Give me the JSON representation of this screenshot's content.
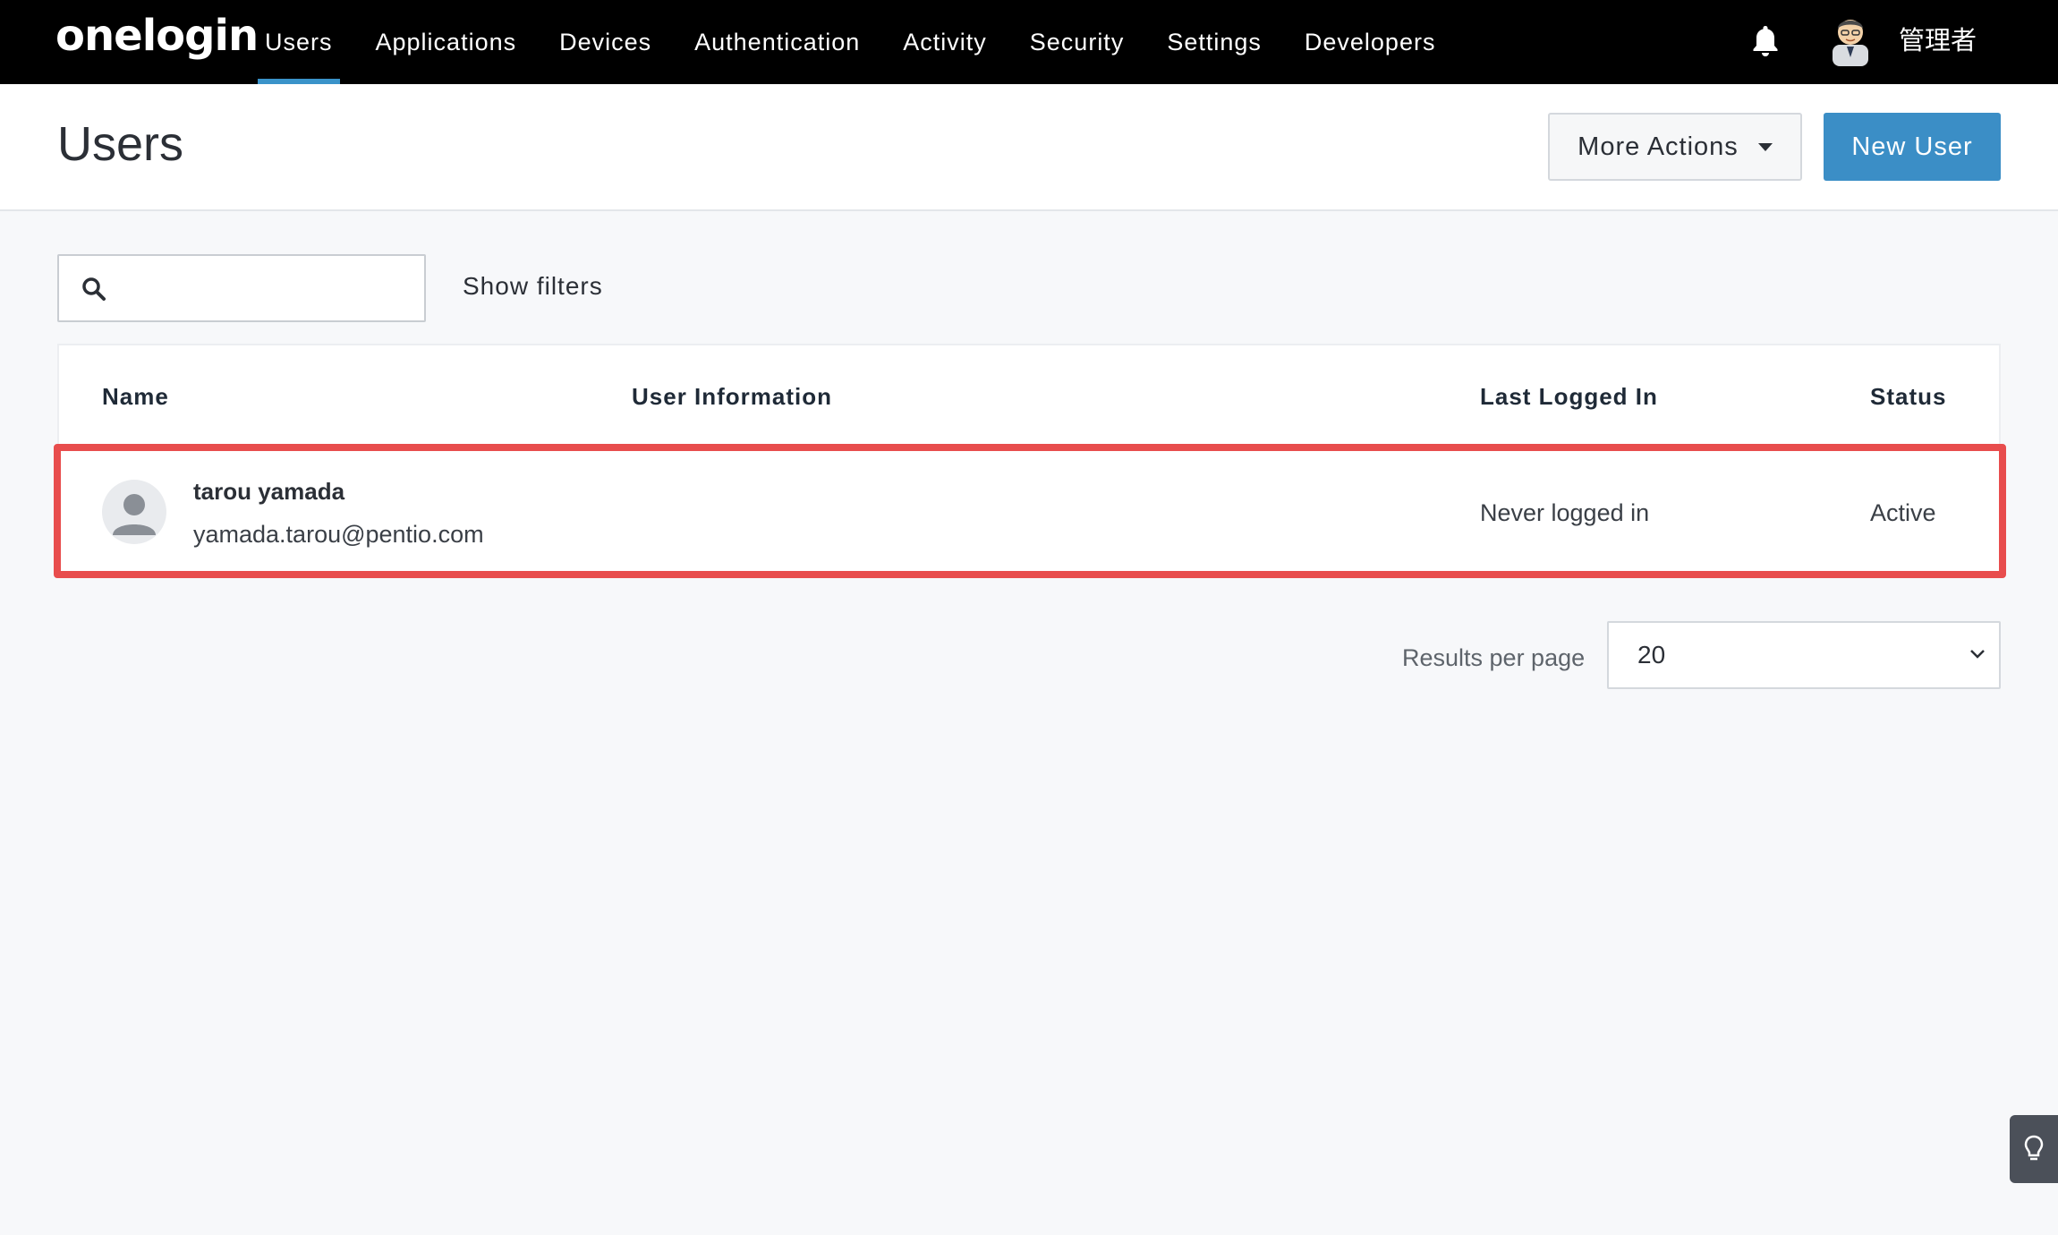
{
  "app": {
    "logo_text": "onelogin"
  },
  "nav": {
    "items": [
      {
        "label": "Users"
      },
      {
        "label": "Applications"
      },
      {
        "label": "Devices"
      },
      {
        "label": "Authentication"
      },
      {
        "label": "Activity"
      },
      {
        "label": "Security"
      },
      {
        "label": "Settings"
      },
      {
        "label": "Developers"
      }
    ],
    "active": "Users",
    "active_color": "#3a93c9",
    "admin_name": "管理者",
    "notification_icon": "bell-icon"
  },
  "header": {
    "title": "Users",
    "more_actions_label": "More Actions",
    "new_user_label": "New User",
    "new_user_color": "#3b8ec6"
  },
  "toolbar": {
    "search_placeholder": "",
    "search_value": "",
    "show_filters_label": "Show filters"
  },
  "table": {
    "columns": {
      "name": "Name",
      "user_information": "User Information",
      "last_logged_in": "Last Logged In",
      "status": "Status"
    },
    "rows": [
      {
        "name": "tarou yamada",
        "email": "yamada.tarou@pentio.com",
        "last_logged_in": "Never logged in",
        "status": "Active"
      }
    ],
    "highlight_color": "#e84d4d"
  },
  "pagination": {
    "results_per_page_label": "Results per page",
    "results_per_page_value": "20"
  }
}
